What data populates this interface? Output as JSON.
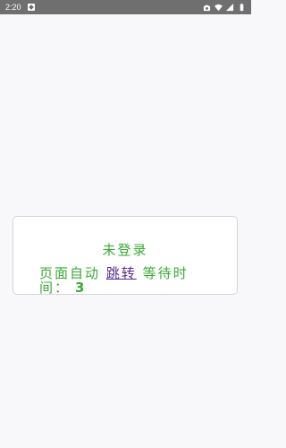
{
  "status_bar": {
    "time": "2:20",
    "icons": [
      "notification-icon",
      "camera-icon",
      "wifi-icon",
      "signal-icon",
      "battery-icon"
    ]
  },
  "dialog": {
    "title": "未登录",
    "message_prefix": "页面自动",
    "link_text": "跳转",
    "message_suffix": "等待时间：",
    "countdown": "3"
  },
  "colors": {
    "accent_green": "#3aaa35",
    "link_purple": "#5a2a91",
    "status_bar": "#6f6f6f",
    "background": "#f8f8fb"
  }
}
